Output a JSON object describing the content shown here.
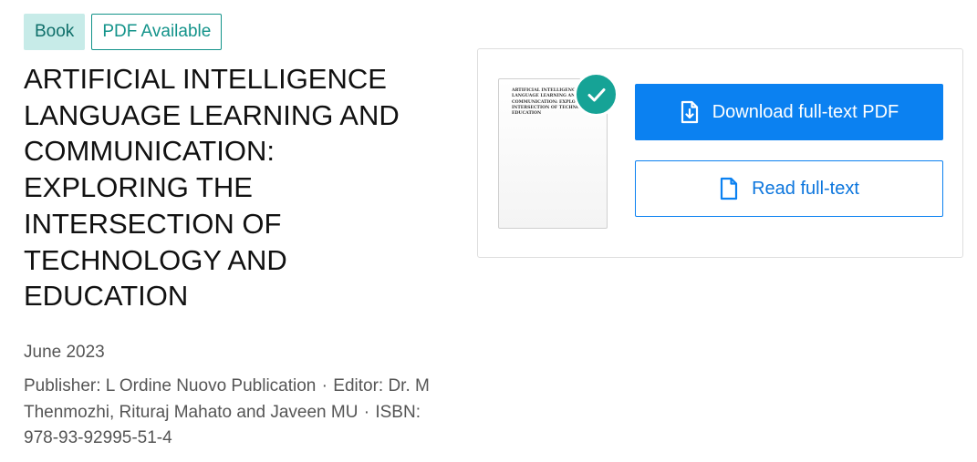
{
  "badges": {
    "book": "Book",
    "pdf": "PDF Available"
  },
  "publication": {
    "title": "ARTIFICIAL INTELLIGENCE LANGUAGE LEARNING AND COMMUNICATION: EXPLORING THE INTERSECTION OF TECHNOLOGY AND EDUCATION",
    "date": "June 2023",
    "publisher_label": "Publisher: L Ordine Nuovo Publication",
    "separator": "·",
    "editor_label": "Editor: Dr. M Thenmozhi, Rituraj Mahato and Javeen MU",
    "isbn_label": "ISBN: 978-93-92995-51-4"
  },
  "fulltext": {
    "thumbnail_text": "ARTIFICIAL INTELLIGENCE LANGUAGE LEARNING AND COMMUNICATION: EXPLORING THE INTERSECTION OF TECHNOLOGY AND EDUCATION",
    "download_label": "Download full-text PDF",
    "read_label": "Read full-text"
  },
  "icons": {
    "check": "check-icon",
    "download": "file-download-icon",
    "read": "file-icon"
  },
  "colors": {
    "accent_blue": "#0b81f1",
    "teal": "#13938a",
    "badge_bg": "#c7ebe8",
    "check_green": "#16a396"
  }
}
